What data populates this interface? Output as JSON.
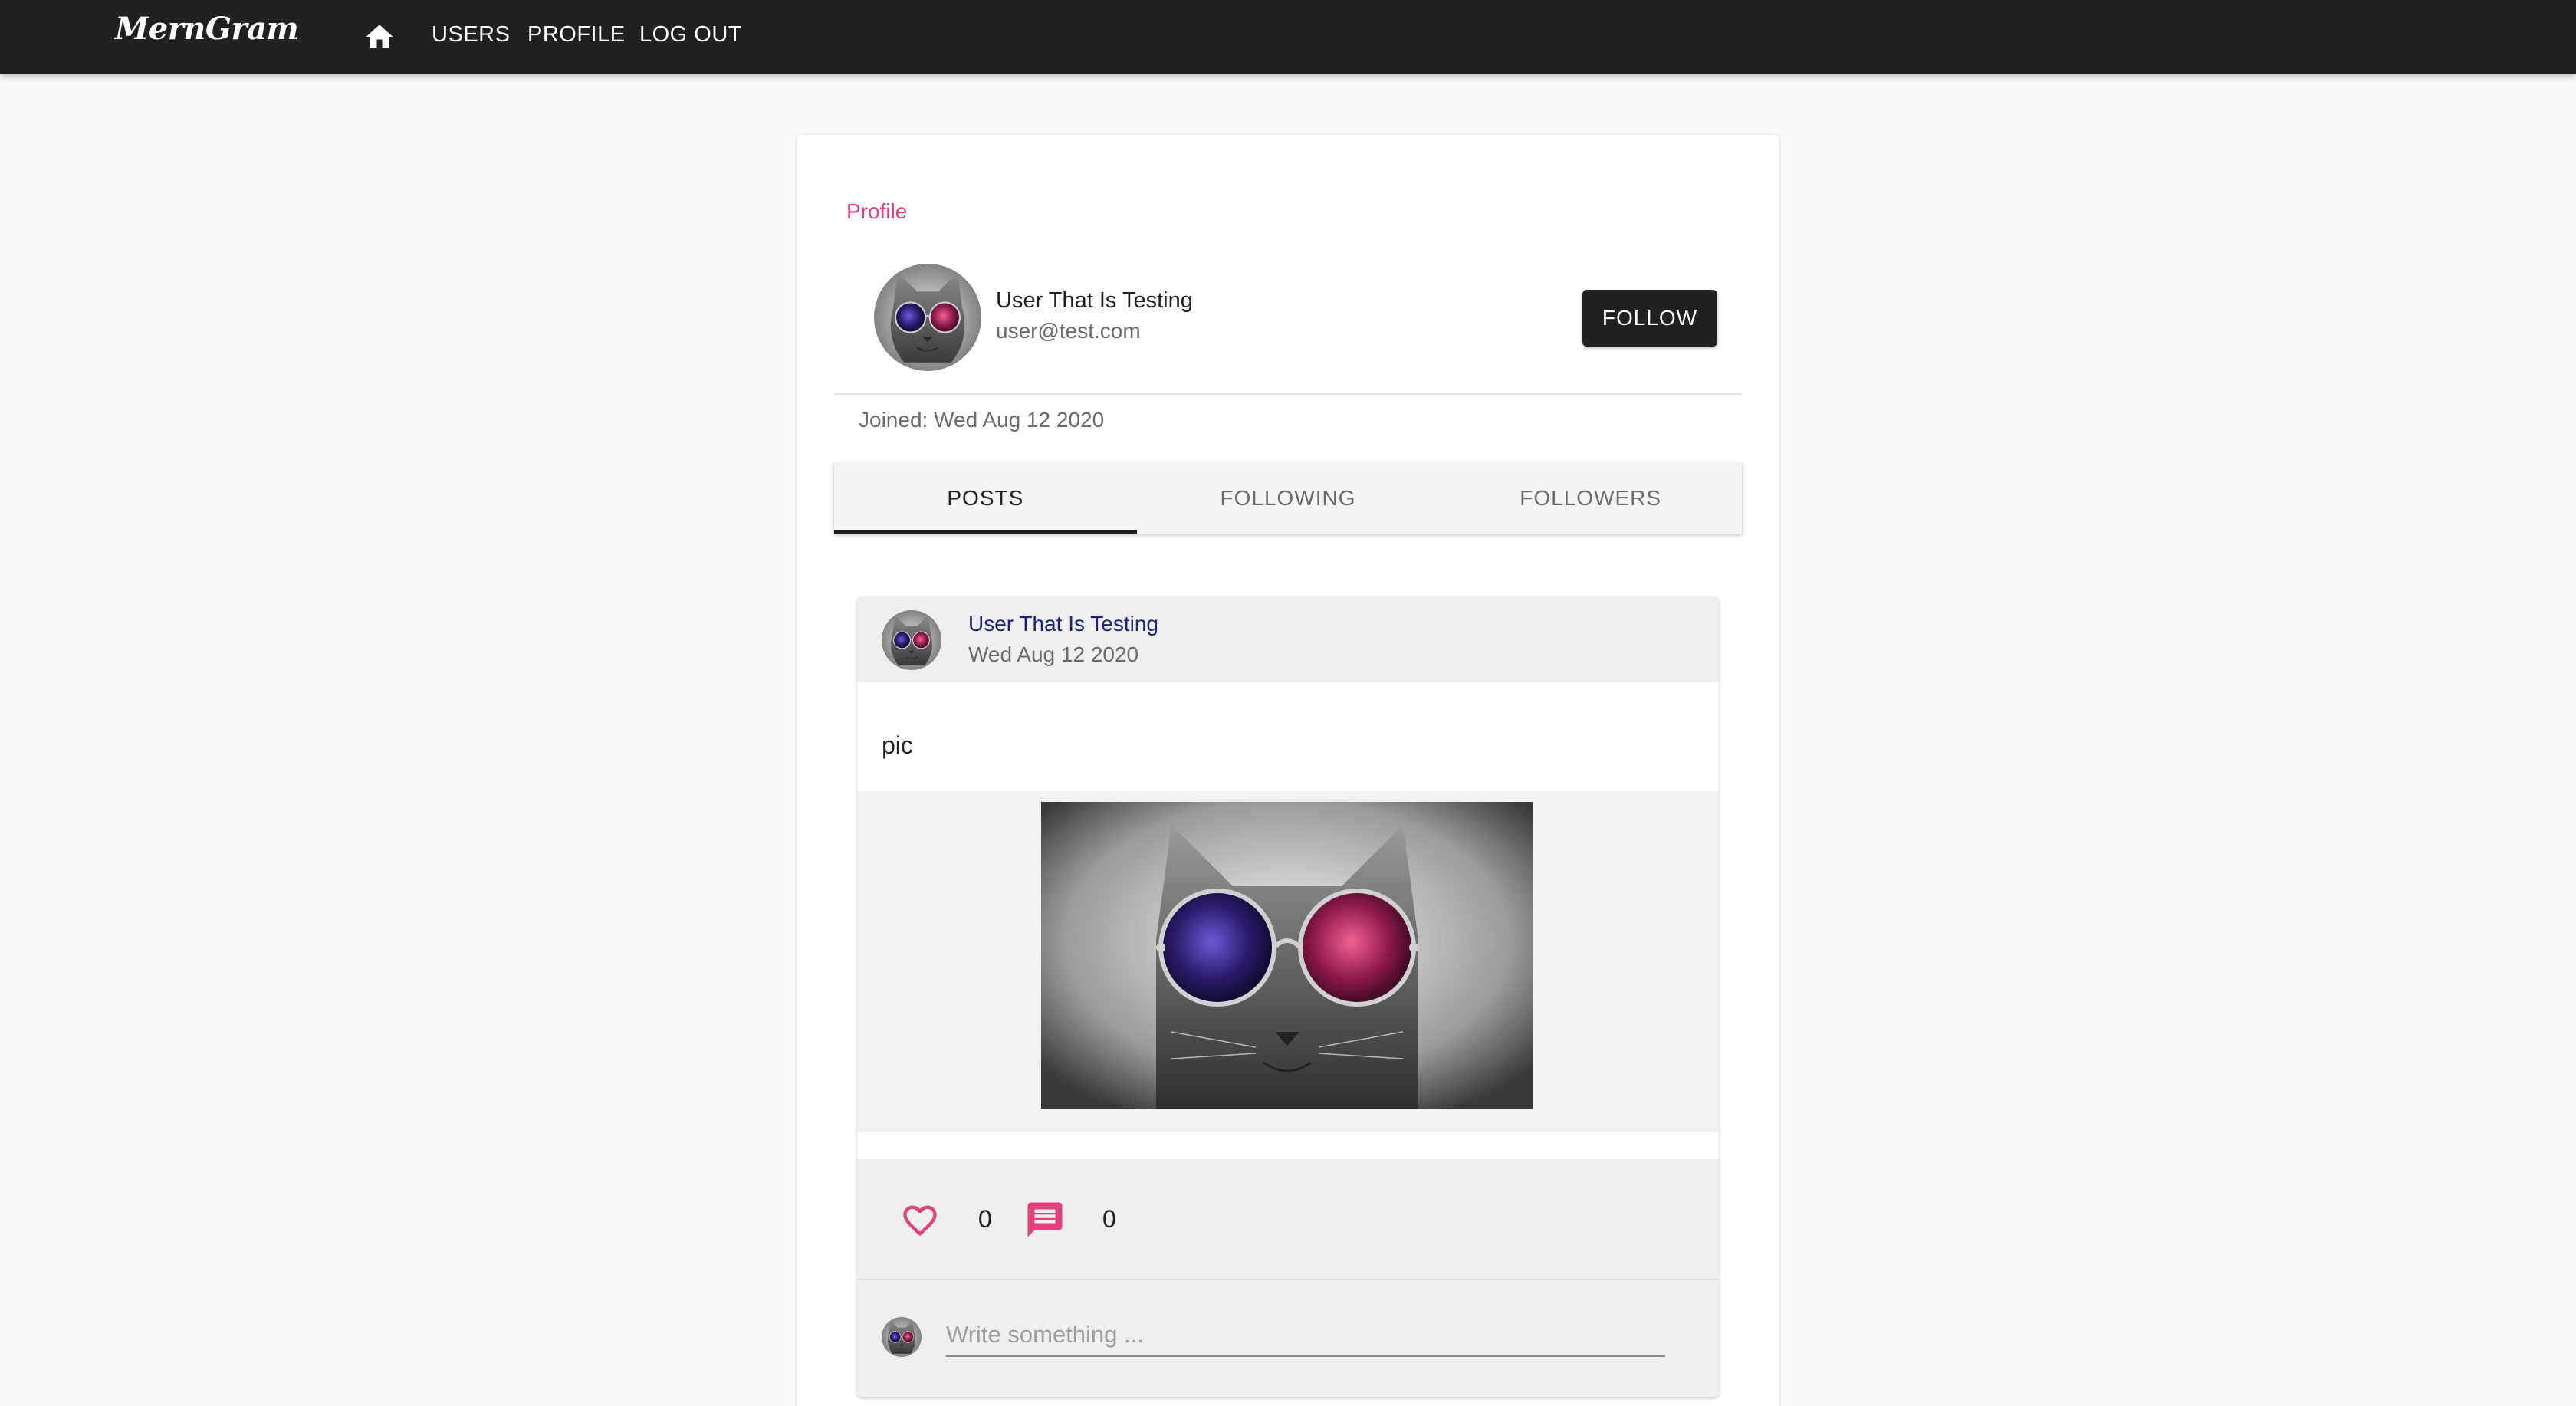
{
  "app": {
    "brand": "MernGram",
    "nav": {
      "home_icon": "home-icon",
      "users": "USERS",
      "profile": "PROFILE",
      "logout": "LOG OUT"
    }
  },
  "profile": {
    "card_title": "Profile",
    "name": "User That Is Testing",
    "email": "user@test.com",
    "follow_label": "FOLLOW",
    "joined": "Joined: Wed Aug 12 2020",
    "tabs": [
      {
        "label": "POSTS",
        "active": true
      },
      {
        "label": "FOLLOWING",
        "active": false
      },
      {
        "label": "FOLLOWERS",
        "active": false
      }
    ]
  },
  "post": {
    "author": "User That Is Testing",
    "date": "Wed Aug 12 2020",
    "text": "pic",
    "likes": "0",
    "comments": "0",
    "like_icon": "heart-outline-icon",
    "comment_icon": "comment-icon",
    "comment_placeholder": "Write something ..."
  },
  "colors": {
    "appbar": "#212121",
    "accent_pink": "#e0427e",
    "author_link": "#1a237e",
    "follow_button": "#212121"
  }
}
